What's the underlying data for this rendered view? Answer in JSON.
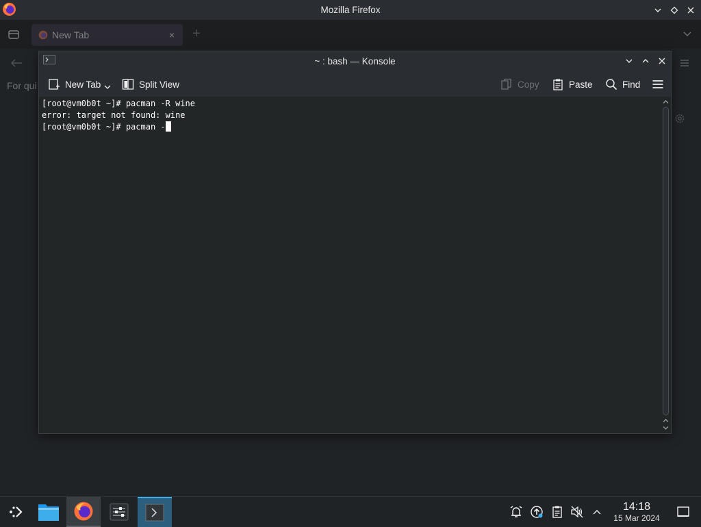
{
  "firefox": {
    "window_title": "Mozilla Firefox",
    "tab_label": "New Tab",
    "tab_close": "×",
    "new_tab_plus": "+",
    "quick_text": "For qui",
    "icons": [
      "firefox-icon",
      "tabs-icon",
      "close-icon",
      "plus-icon",
      "chevron-down-icon",
      "back-arrow-icon",
      "menu-icon",
      "gear-icon"
    ]
  },
  "konsole": {
    "window_title": "~ : bash — Konsole",
    "toolbar": {
      "new_tab": "New Tab",
      "split_view": "Split View",
      "copy": "Copy",
      "paste": "Paste",
      "find": "Find"
    },
    "terminal_lines": [
      "[root@vm0b0t ~]# pacman -R wine",
      "error: target not found: wine",
      "[root@vm0b0t ~]# pacman -"
    ]
  },
  "taskbar": {
    "items": [
      "application-launcher-icon",
      "dolphin-files-icon",
      "firefox-icon",
      "audio-mixer-icon",
      "konsole-icon"
    ],
    "active": "konsole",
    "tray_icons": [
      "alarm-icon",
      "update-icon",
      "clipboard-icon",
      "volume-muted-icon",
      "expand-tray-icon"
    ],
    "clock_time": "14:18",
    "clock_date": "15 Mar 2024"
  },
  "colors": {
    "accent": "#3daee9",
    "window_bg": "#2a2e32",
    "terminal_bg": "#232627",
    "terminal_fg": "#fcfcfc"
  }
}
